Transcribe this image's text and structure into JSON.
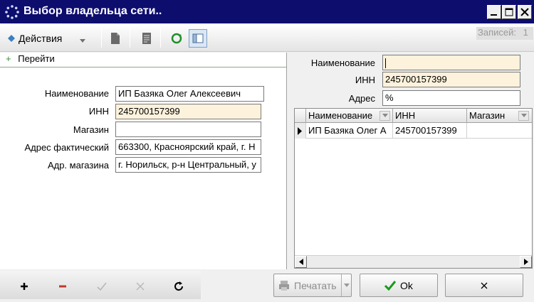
{
  "window": {
    "title": "Выбор владельца сети.."
  },
  "toolbar": {
    "actions_label": "Действия",
    "records_label": "Записей:",
    "records_count": "1"
  },
  "left": {
    "goto_label": "Перейти",
    "fields": [
      {
        "label": "Наименование",
        "value": "ИП Базяка Олег  Алексеевич"
      },
      {
        "label": "ИНН",
        "value": "245700157399"
      },
      {
        "label": "Магазин",
        "value": ""
      },
      {
        "label": "Адрес фактический",
        "value": "663300, Красноярский край, г. Н"
      },
      {
        "label": "Адр. магазина",
        "value": "г. Норильск, р-н Центральный, у"
      }
    ]
  },
  "right": {
    "filters": [
      {
        "label": "Наименование",
        "value": ""
      },
      {
        "label": "ИНН",
        "value": "245700157399"
      },
      {
        "label": "Адрес",
        "value": "%"
      }
    ],
    "grid": {
      "columns": [
        "Наименование",
        "ИНН",
        "Магазин"
      ],
      "rows": [
        [
          "ИП Базяка Олег  А",
          "245700157399",
          ""
        ]
      ]
    }
  },
  "bottom": {
    "print_label": "Печатать",
    "ok_label": "Ok"
  },
  "colors": {
    "titlebar": "#0d0d6e",
    "field_highlight": "#fdf2dc",
    "ok_check": "#1a9a1a",
    "minus": "#c0392b"
  }
}
